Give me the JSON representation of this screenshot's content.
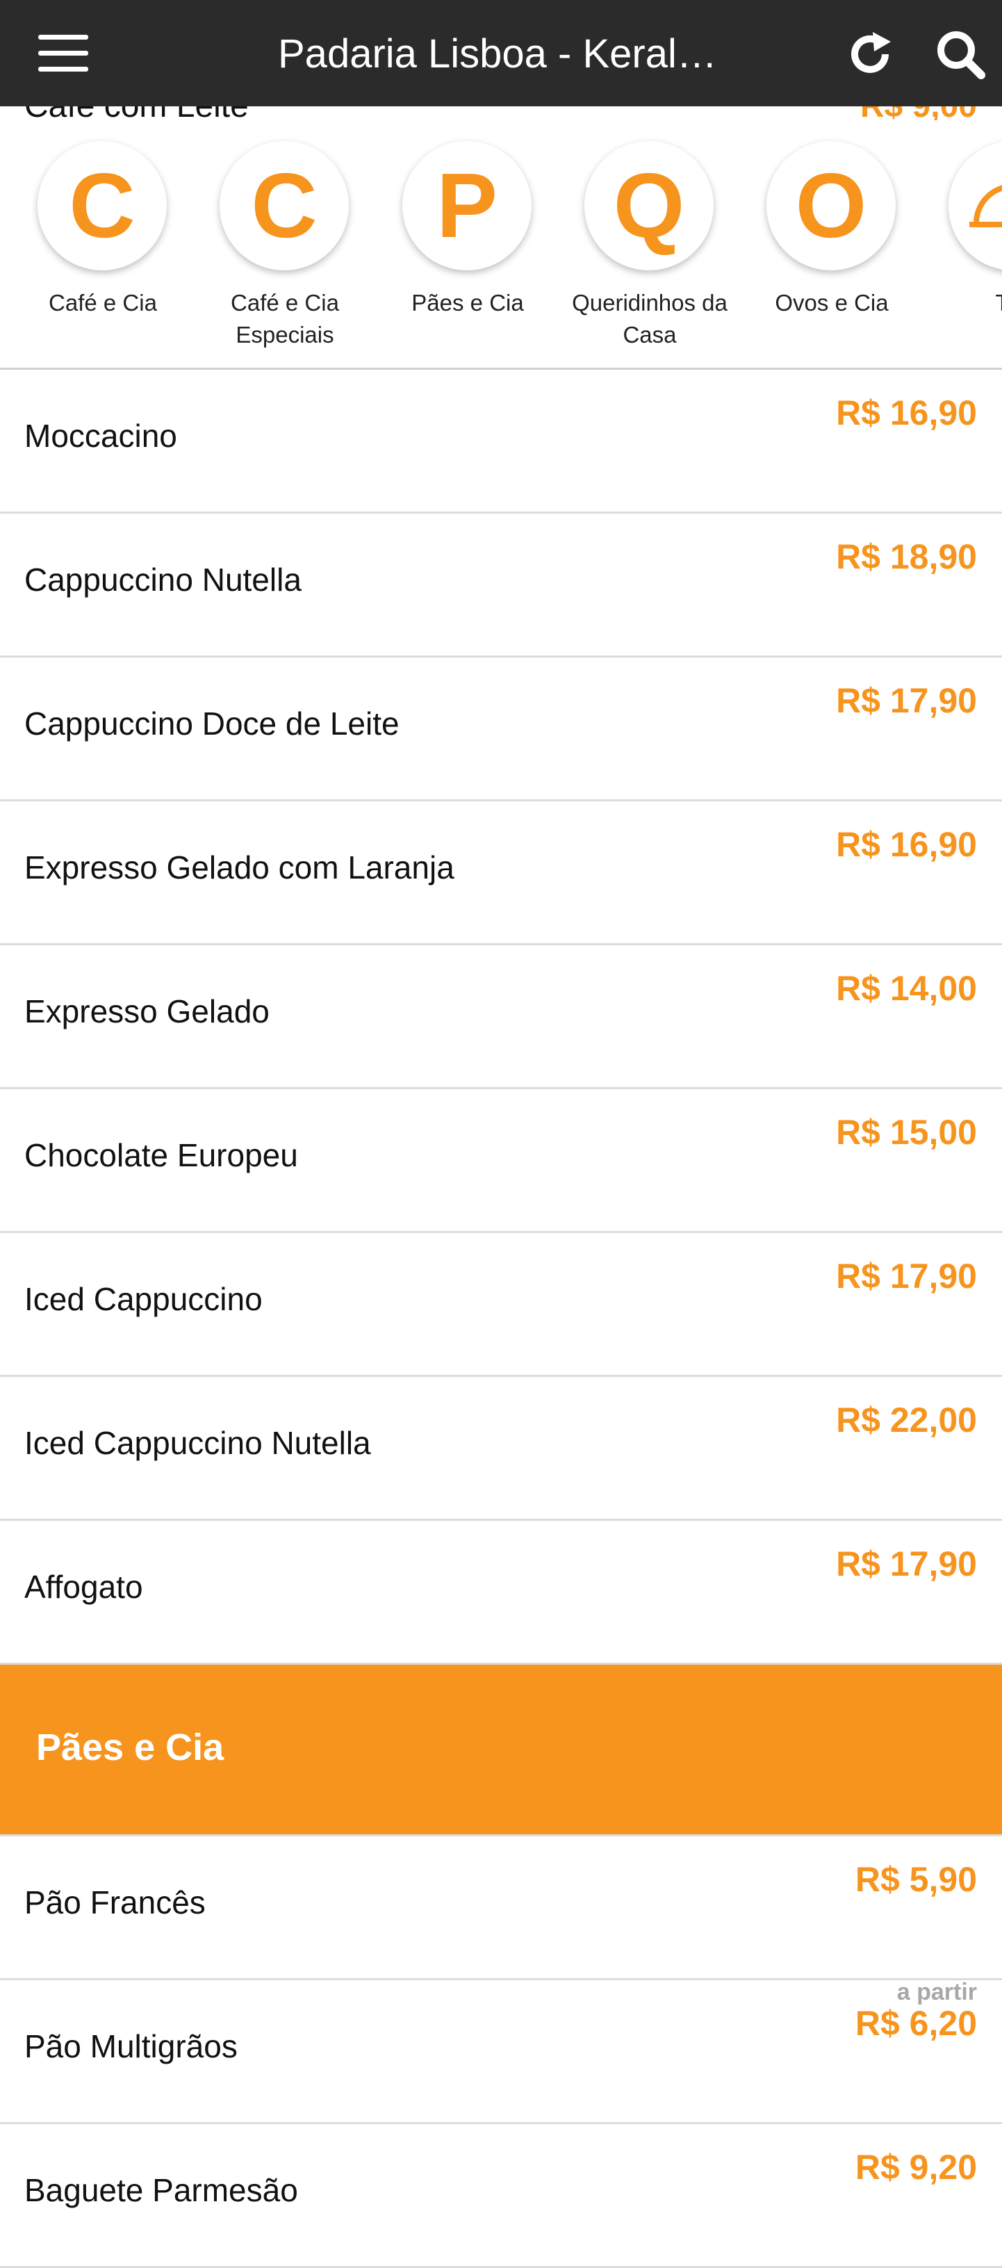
{
  "header": {
    "title": "Padaria Lisboa - Keral…",
    "refresh_icon": "refresh-icon",
    "search_icon": "search-icon",
    "menu_icon": "hamburger-menu-icon",
    "accent_color": "#f7941d",
    "bar_color": "#2b2b2b"
  },
  "categories": [
    {
      "letter": "C",
      "label": "Café e Cia"
    },
    {
      "letter": "C",
      "label": "Café e Cia Especiais"
    },
    {
      "letter": "P",
      "label": "Pães e Cia"
    },
    {
      "letter": "Q",
      "label": "Queridinhos da Casa"
    },
    {
      "letter": "O",
      "label": "Ovos e Cia"
    },
    {
      "letter": "",
      "label": "Tap"
    }
  ],
  "menu_items": [
    {
      "name": "Moccacino",
      "price": "R$ 16,90"
    },
    {
      "name": "Cappuccino Nutella",
      "price": "R$ 18,90"
    },
    {
      "name": "Cappuccino Doce de Leite",
      "price": "R$ 17,90"
    },
    {
      "name": "Expresso Gelado com Laranja",
      "price": "R$ 16,90"
    },
    {
      "name": "Expresso Gelado",
      "price": "R$ 14,00"
    },
    {
      "name": "Chocolate Europeu",
      "price": "R$ 15,00"
    },
    {
      "name": "Iced Cappuccino",
      "price": "R$ 17,90"
    },
    {
      "name": "Iced Cappuccino Nutella",
      "price": "R$ 22,00"
    },
    {
      "name": "Affogato",
      "price": "R$ 17,90"
    }
  ],
  "section": {
    "title": "Pães e Cia",
    "items": [
      {
        "name": "Pão Francês",
        "price": "R$ 5,90",
        "prefix": ""
      },
      {
        "name": "Pão Multigrãos",
        "price": "R$ 6,20",
        "prefix": "a partir"
      },
      {
        "name": "Baguete Parmesão",
        "price": "R$ 9,20",
        "prefix": ""
      }
    ]
  }
}
